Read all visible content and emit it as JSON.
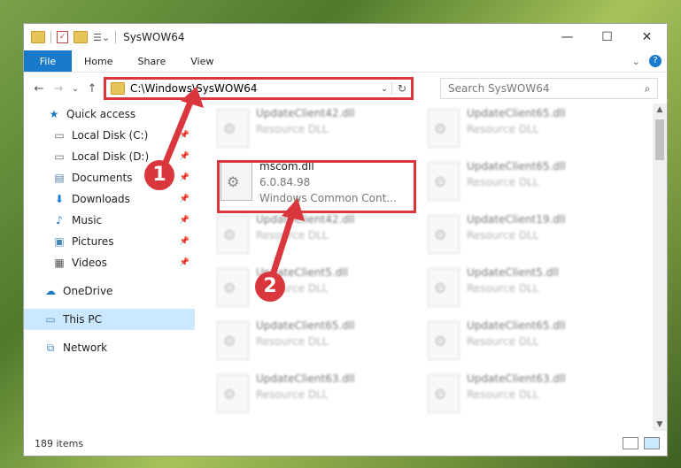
{
  "window": {
    "title": "SysWOW64",
    "minimize": "—",
    "maximize": "☐",
    "close": "✕"
  },
  "ribbon": {
    "file": "File",
    "home": "Home",
    "share": "Share",
    "view": "View",
    "expand": "⌄",
    "help": "?"
  },
  "nav": {
    "back": "←",
    "forward": "→",
    "recent": "⌄",
    "up": "↑",
    "path": "C:\\Windows\\SysWOW64",
    "dropdown": "⌄",
    "refresh": "↻",
    "search_placeholder": "Search SysWOW64",
    "search_icon": "⌕"
  },
  "sidebar": {
    "items": [
      {
        "label": "Quick access",
        "icon": "star-icon"
      },
      {
        "label": "Local Disk (C:)",
        "icon": "drive-icon"
      },
      {
        "label": "Local Disk (D:)",
        "icon": "drive-icon"
      },
      {
        "label": "Documents",
        "icon": "documents-icon"
      },
      {
        "label": "Downloads",
        "icon": "download-icon"
      },
      {
        "label": "Music",
        "icon": "music-icon"
      },
      {
        "label": "Pictures",
        "icon": "pictures-icon"
      },
      {
        "label": "Videos",
        "icon": "videos-icon"
      },
      {
        "label": "OneDrive",
        "icon": "cloud-icon"
      },
      {
        "label": "This PC",
        "icon": "computer-icon"
      },
      {
        "label": "Network",
        "icon": "network-icon"
      }
    ]
  },
  "files": [
    {
      "name": "UpdateClient42.dll",
      "type": "Resource DLL"
    },
    {
      "name": "UpdateClient65.dll",
      "type": "Resource DLL"
    },
    {
      "name": "mscom.dll",
      "version": "6.0.84.98",
      "type": "Windows Common Cont..."
    },
    {
      "name": "UpdateClient65.dll",
      "type": "Resource DLL"
    },
    {
      "name": "UpdateClient42.dll",
      "type": "Resource DLL"
    },
    {
      "name": "UpdateClient19.dll",
      "type": "Resource DLL"
    },
    {
      "name": "UpdateClient5.dll",
      "type": "Resource DLL"
    },
    {
      "name": "UpdateClient5.dll",
      "type": "Resource DLL"
    },
    {
      "name": "UpdateClient65.dll",
      "type": "Resource DLL"
    },
    {
      "name": "UpdateClient65.dll",
      "type": "Resource DLL"
    },
    {
      "name": "UpdateClient63.dll",
      "type": "Resource DLL"
    },
    {
      "name": "UpdateClient63.dll",
      "type": "Resource DLL"
    }
  ],
  "status": {
    "count": "189 items"
  },
  "annotations": {
    "marker1": "1",
    "marker2": "2",
    "color": "#d9363e"
  }
}
